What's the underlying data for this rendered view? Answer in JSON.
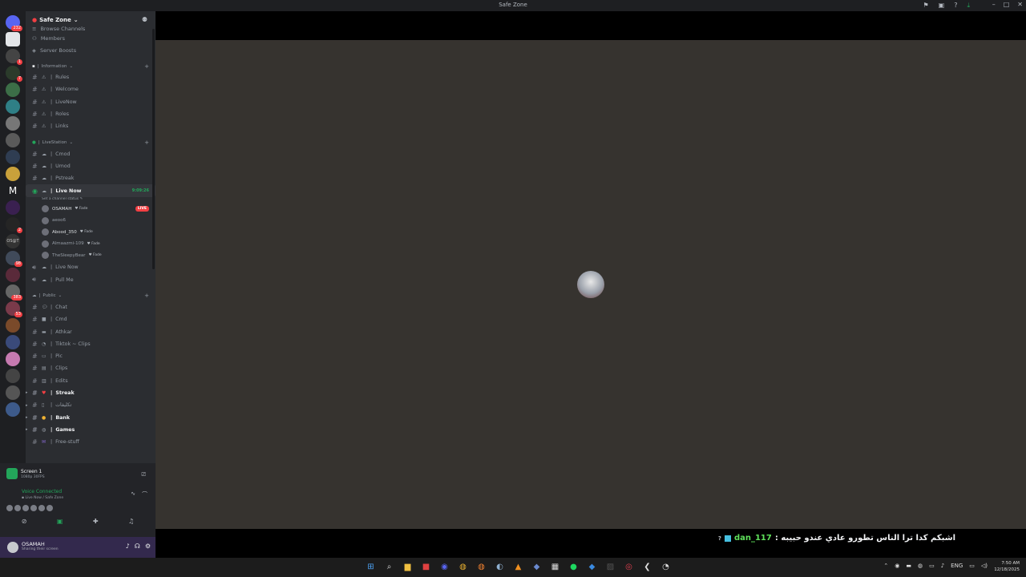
{
  "window": {
    "title": "Safe Zone"
  },
  "server": {
    "name": "Safe Zone"
  },
  "colors": {
    "accent": "#23a55a",
    "live": "#f23f43",
    "stage_bg": "#36332f",
    "user_panel": "#33294d"
  },
  "guild_badges": [
    "232",
    "1",
    "7",
    "2",
    "98",
    "383",
    "53"
  ],
  "nav": [
    "Browse Channels",
    "Members",
    "Server Boosts"
  ],
  "categories": {
    "information": "Information",
    "livestation": "LiveStation",
    "public": "Public"
  },
  "information_channels": [
    "Rules",
    "Welcome",
    "LiveNow",
    "Roles",
    "Links"
  ],
  "livestation_channels": [
    "Cmod",
    "Umod",
    "Pstreak"
  ],
  "live_now": {
    "name": "Live Now",
    "timer": "9:09:26",
    "status": "Set a channel status"
  },
  "voice_users": [
    {
      "name": "OSAMAH",
      "tag": "Fade",
      "live": "LIVE"
    },
    {
      "name": "aeoo6"
    },
    {
      "name": "Abood_350",
      "tag": "Fade"
    },
    {
      "name": "Almaazmi-109",
      "tag": "Fade"
    },
    {
      "name": "TheSleepyBear",
      "tag": "Fade"
    }
  ],
  "voice_channels_after": [
    "Live Now",
    "Pull Me"
  ],
  "public_channels": [
    {
      "name": "Chat",
      "bold": false
    },
    {
      "name": "Cmd",
      "bold": false
    },
    {
      "name": "Athkar",
      "bold": false
    },
    {
      "name": "Tiktok ~ Clips",
      "bold": false
    },
    {
      "name": "Pic",
      "bold": false
    },
    {
      "name": "Clips",
      "bold": false
    },
    {
      "name": "Edits",
      "bold": false
    },
    {
      "name": "Streak",
      "bold": true
    },
    {
      "name": "تكليفات",
      "bold": false
    },
    {
      "name": "Bank",
      "bold": true
    },
    {
      "name": "Games",
      "bold": true
    },
    {
      "name": "Free-stuff",
      "bold": false
    }
  ],
  "stream_panel": {
    "title": "Screen 1",
    "sub": "1080p 30FPS"
  },
  "voice_panel": {
    "status": "Voice Connected",
    "location": "Live Now / Safe Zone"
  },
  "user": {
    "name": "OSAMAH",
    "status": "Sharing their screen"
  },
  "caption": {
    "user": "dan_117",
    "message": "اشبكم كدا ترا الناس تطورو عادي عندو حبيبه :"
  },
  "clock": {
    "time": "7:50 AM",
    "date": "12/18/2025"
  },
  "tray": {
    "lang": "ENG"
  }
}
